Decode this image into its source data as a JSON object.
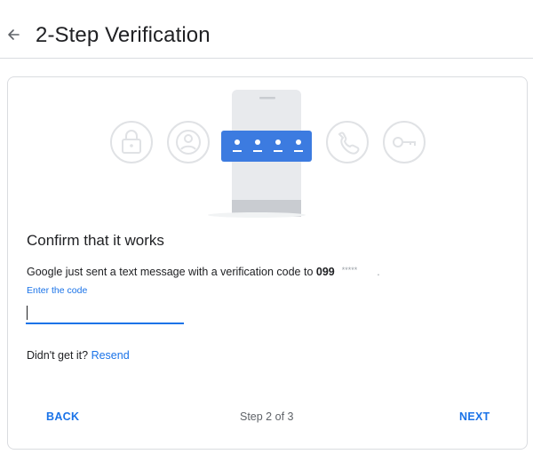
{
  "header": {
    "back_icon": "arrow-left-icon",
    "title": "2-Step Verification"
  },
  "illustration": {
    "icons": [
      "lock-icon",
      "account-icon",
      "phone-call-icon",
      "key-icon"
    ],
    "accent_color": "#1a73e8",
    "phone_color": "#e8eaed",
    "code_bar_color": "#3c7be0"
  },
  "card": {
    "heading": "Confirm that it works",
    "message_prefix": "Google just sent a text message with a verification code to ",
    "phone_prefix": "099",
    "phone_masked": "*****",
    "phone_suffix": ".",
    "code_label": "Enter the code",
    "code_value": "",
    "resend_prefix": "Didn't get it? ",
    "resend_link": "Resend"
  },
  "footer": {
    "back_label": "BACK",
    "step_text": "Step 2 of 3",
    "next_label": "NEXT"
  },
  "colors": {
    "link": "#1a73e8",
    "text": "#202124",
    "muted": "#5f6368",
    "divider": "#dadce0"
  }
}
